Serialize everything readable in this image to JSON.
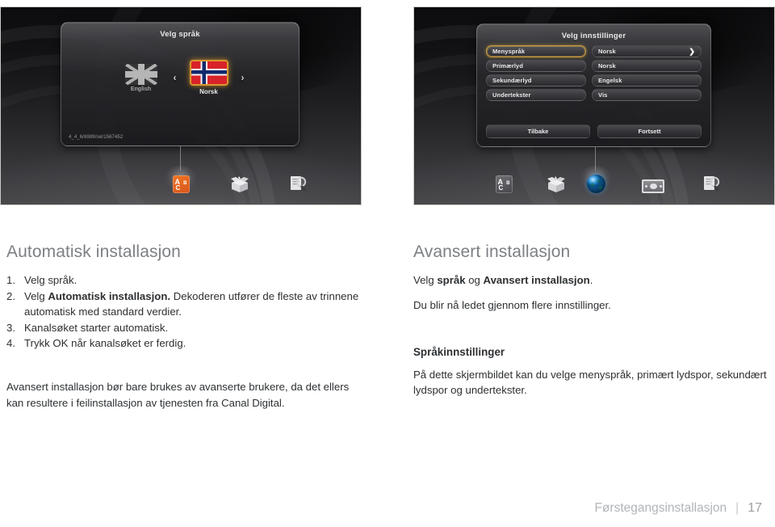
{
  "screens": {
    "left": {
      "name": "velg-sprak-screen",
      "dialog_title": "Velg språk",
      "version_string": "4_4_6/6989/rel/1567452",
      "prev_arrow": "‹",
      "next_arrow": "›",
      "languages": [
        {
          "label": "English",
          "flag": "uk-flag-icon",
          "selected": false
        },
        {
          "label": "Norsk",
          "flag": "norway-flag-icon",
          "selected": true
        }
      ],
      "dock_icons": [
        {
          "name": "abc-language-icon",
          "active": true
        },
        {
          "name": "open-box-installation-icon",
          "active": false
        },
        {
          "name": "document-search-icon",
          "active": false
        }
      ]
    },
    "right": {
      "name": "velg-innstillinger-screen",
      "dialog_title": "Velg innstillinger",
      "settings": [
        {
          "key": "Menyspråk",
          "value": "Norsk",
          "selected": true,
          "arrow": "❯"
        },
        {
          "key": "Primærlyd",
          "value": "Norsk",
          "selected": false,
          "arrow": ""
        },
        {
          "key": "Sekundærlyd",
          "value": "Engelsk",
          "selected": false,
          "arrow": ""
        },
        {
          "key": "Undertekster",
          "value": "Vis",
          "selected": false,
          "arrow": ""
        }
      ],
      "buttons": [
        {
          "label": "Tilbake",
          "name": "tilbake-button"
        },
        {
          "label": "Fortsett",
          "name": "fortsett-button"
        }
      ],
      "dock_icons": [
        {
          "name": "abc-language-icon",
          "active": false
        },
        {
          "name": "open-box-installation-icon",
          "active": false
        },
        {
          "name": "globe-settings-icon",
          "active": true
        },
        {
          "name": "smartcard-icon",
          "active": false
        },
        {
          "name": "document-search-icon",
          "active": false
        }
      ]
    }
  },
  "left_column": {
    "heading": "Automatisk installasjon",
    "steps": [
      {
        "num": "1.",
        "pre": "Velg språk.",
        "bold": "",
        "post": ""
      },
      {
        "num": "2.",
        "pre": "Velg ",
        "bold": "Automatisk installasjon.",
        "post": " Dekoderen utfører de fleste av trinnene automatisk med standard verdier."
      },
      {
        "num": "3.",
        "pre": "Kanalsøket starter automatisk.",
        "bold": "",
        "post": ""
      },
      {
        "num": "4.",
        "pre": "Trykk OK når kanalsøket er ferdig.",
        "bold": "",
        "post": ""
      }
    ],
    "note": "Avansert installasjon bør bare brukes av avanserte brukere, da det ellers kan resultere i feilinstallasjon av tjenesten fra Canal Digital."
  },
  "right_column": {
    "heading": "Avansert installasjon",
    "line1_pre": "Velg ",
    "line1_bold1": "språk",
    "line1_mid": " og ",
    "line1_bold2": "Avansert installasjon",
    "line1_post": ".",
    "line2": "Du blir nå ledet gjennom flere innstillinger.",
    "subheading": "Språkinnstillinger",
    "paragraph": "På dette skjermbildet kan du velge menyspråk, primært lydspor, sekundært lydspor og undertekster."
  },
  "footer": {
    "section": "Førstegangsinstallasjon",
    "separator": "|",
    "page": "17"
  },
  "colors": {
    "heading_gray": "#7d8084",
    "body_text": "#2d3033",
    "accent_orange": "#d9972c",
    "footer_gray": "#b2b5b8",
    "screen_dark": "#1b1b1d"
  }
}
